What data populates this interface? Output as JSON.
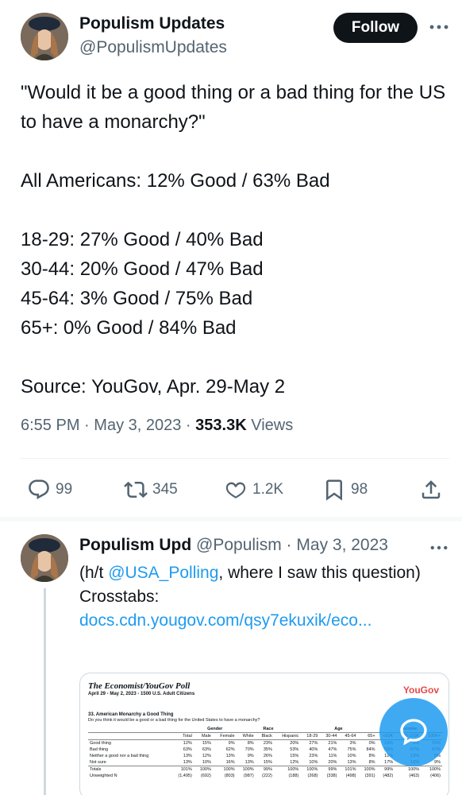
{
  "tweet": {
    "author_name": "Populism Updates",
    "author_handle": "@PopulismUpdates",
    "follow_label": "Follow",
    "lines": [
      "\"Would it be a good thing or a bad thing for the US to have a monarchy?\"",
      "",
      "All Americans: 12% Good / 63% Bad",
      "",
      "18-29: 27% Good / 40% Bad",
      "30-44: 20% Good / 47% Bad",
      "45-64: 3% Good / 75% Bad",
      "65+: 0% Good / 84% Bad",
      "",
      "Source: YouGov, Apr. 29-May 2"
    ],
    "time": "6:55 PM",
    "date": "May 3, 2023",
    "views_count": "353.3K",
    "views_label": "Views",
    "separator": "·"
  },
  "actions": {
    "replies": "99",
    "retweets": "345",
    "likes": "1.2K",
    "bookmarks": "98"
  },
  "reply": {
    "author_name": "Populism Upd",
    "author_handle": "@Populism",
    "date": "May 3, 2023",
    "separator": "·",
    "text_prefix": "(h/t ",
    "mention": "@USA_Polling",
    "text_suffix": ", where I saw this question)",
    "crosstabs_label": "Crosstabs:",
    "link": "docs.cdn.yougov.com/qsy7ekuxik/eco..."
  },
  "card": {
    "poll_title": "The Economist/YouGov Poll",
    "poll_sub": "April 29 - May 2, 2023 - 1500 U.S. Adult Citizens",
    "brand": "YouGov",
    "question_title": "33. American Monarchy a Good Thing",
    "question_sub": "Do you think it would be a good or a bad thing for the United States to have a monarchy?",
    "groups": [
      "",
      "",
      "Gender",
      "",
      "Race",
      "",
      "Age",
      "",
      "Income"
    ],
    "columns": [
      "",
      "Total",
      "Male",
      "Female",
      "White",
      "Black",
      "Hispanic",
      "18-29",
      "30-44",
      "45-64",
      "65+",
      "<50K",
      "50-100K",
      "100K+"
    ],
    "rows": [
      [
        "Good thing",
        "12%",
        "15%",
        "9%",
        "8%",
        "23%",
        "20%",
        "27%",
        "21%",
        "3%",
        "0%",
        "15%",
        "8%",
        "15%"
      ],
      [
        "Bad thing",
        "63%",
        "63%",
        "62%",
        "70%",
        "35%",
        "53%",
        "40%",
        "47%",
        "75%",
        "84%",
        "55%",
        "67%",
        "67%"
      ],
      [
        "Neither a good nor a bad thing",
        "13%",
        "12%",
        "13%",
        "9%",
        "26%",
        "15%",
        "23%",
        "11%",
        "10%",
        "8%",
        "12%",
        "13%",
        "8%"
      ],
      [
        "Not sure",
        "13%",
        "10%",
        "16%",
        "13%",
        "15%",
        "12%",
        "10%",
        "20%",
        "13%",
        "8%",
        "17%",
        "12%",
        "9%"
      ]
    ],
    "totals": [
      "Totals",
      "101%",
      "100%",
      "100%",
      "100%",
      "99%",
      "100%",
      "100%",
      "99%",
      "101%",
      "100%",
      "99%",
      "100%",
      "100%"
    ],
    "unweighted": [
      "Unweighted N",
      "(1,495)",
      "(692)",
      "(803)",
      "(987)",
      "(222)",
      "(188)",
      "(268)",
      "(338)",
      "(498)",
      "(391)",
      "(482)",
      "(463)",
      "(406)"
    ]
  },
  "colors": {
    "text": "#0f1419",
    "secondary": "#536471",
    "link": "#1d9bf0",
    "follow_bg": "#0f1419",
    "brand_red": "#e4484a"
  }
}
